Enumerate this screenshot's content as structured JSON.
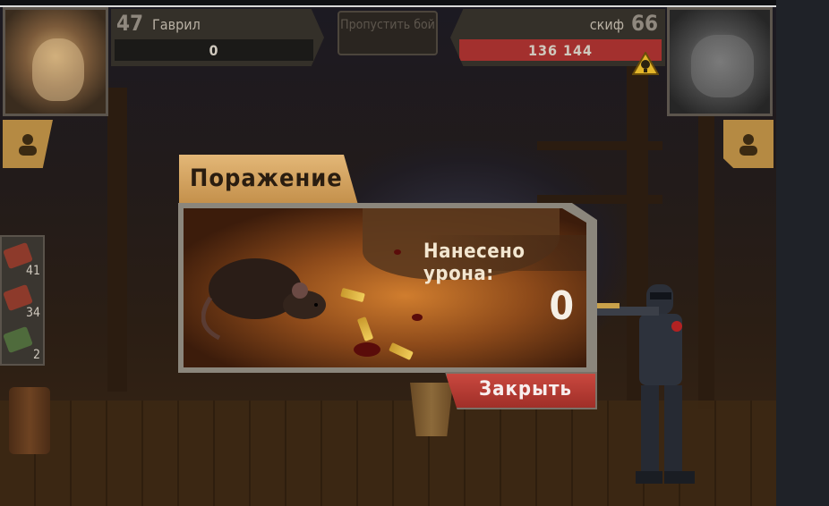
{
  "player": {
    "level": "47",
    "name": "Гаврил",
    "hp": "0"
  },
  "enemy": {
    "level": "66",
    "name": "скиф",
    "hp": "136 144",
    "hp_color": "#a3302e"
  },
  "skip_button": {
    "label": "Пропустить бой"
  },
  "items": [
    {
      "count": "41",
      "icon": "medkit-icon"
    },
    {
      "count": "34",
      "icon": "medkit-icon"
    },
    {
      "count": "2",
      "icon": "medkit-icon"
    }
  ],
  "result": {
    "title": "Поражение",
    "damage_label": "Нанесено урона:",
    "damage_value": "0",
    "close_label": "Закрыть"
  },
  "colors": {
    "accent": "#c38f4a",
    "danger": "#a02f28"
  }
}
